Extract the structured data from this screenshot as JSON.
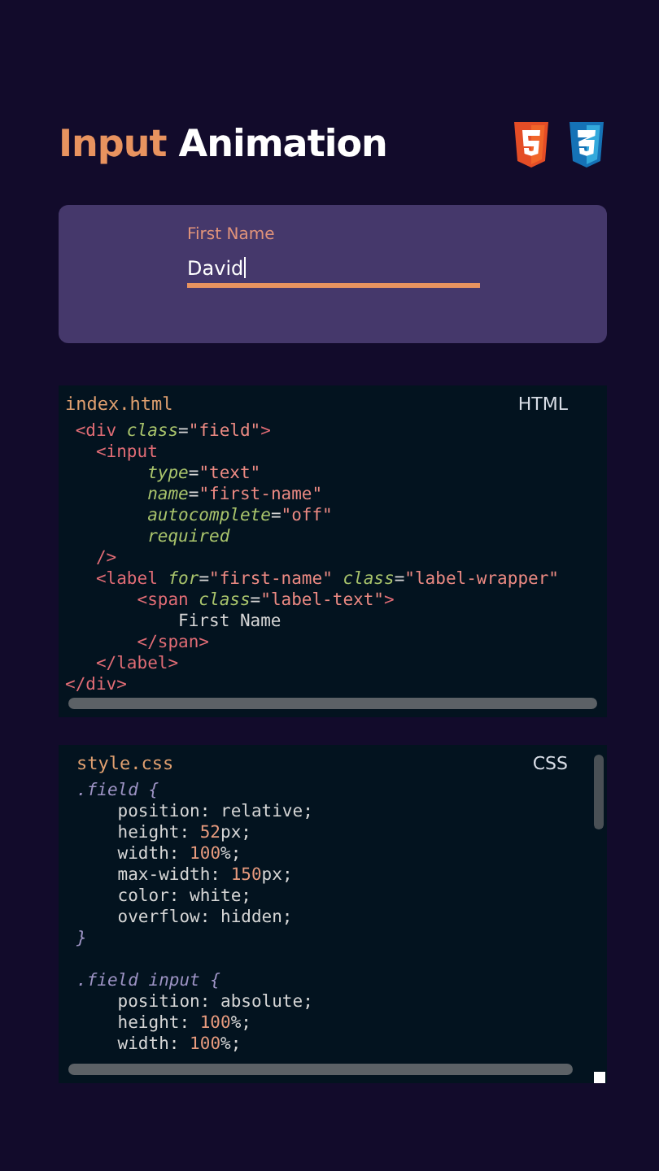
{
  "title": {
    "highlight": "Input",
    "rest": "Animation"
  },
  "form": {
    "label": "First Name",
    "value": "David",
    "focused": true
  },
  "code_panels": [
    {
      "filename": "index.html",
      "language": "HTML",
      "blocks": [
        {
          "lines": [
            {
              "tokens": [
                {
                  "kind": "tag",
                  "text": " <div"
                },
                {
                  "kind": "attr",
                  "text": " class"
                },
                {
                  "kind": "plain",
                  "text": "="
                },
                {
                  "kind": "str",
                  "text": "\"field\""
                },
                {
                  "kind": "tag",
                  "text": ">"
                }
              ]
            },
            {
              "tokens": [
                {
                  "kind": "tag",
                  "text": "   <input"
                }
              ]
            },
            {
              "tokens": [
                {
                  "kind": "attr",
                  "text": "        type"
                },
                {
                  "kind": "plain",
                  "text": "="
                },
                {
                  "kind": "str",
                  "text": "\"text\""
                }
              ]
            },
            {
              "tokens": [
                {
                  "kind": "attr",
                  "text": "        name"
                },
                {
                  "kind": "plain",
                  "text": "="
                },
                {
                  "kind": "str",
                  "text": "\"first-name\""
                }
              ]
            },
            {
              "tokens": [
                {
                  "kind": "attr",
                  "text": "        autocomplete"
                },
                {
                  "kind": "plain",
                  "text": "="
                },
                {
                  "kind": "str",
                  "text": "\"off\""
                }
              ]
            },
            {
              "tokens": [
                {
                  "kind": "attr",
                  "text": "        required"
                }
              ]
            },
            {
              "tokens": [
                {
                  "kind": "tag",
                  "text": "   />"
                }
              ]
            },
            {
              "tokens": [
                {
                  "kind": "tag",
                  "text": "   <label"
                },
                {
                  "kind": "attr",
                  "text": " for"
                },
                {
                  "kind": "plain",
                  "text": "="
                },
                {
                  "kind": "str",
                  "text": "\"first-name\""
                },
                {
                  "kind": "attr",
                  "text": " class"
                },
                {
                  "kind": "plain",
                  "text": "="
                },
                {
                  "kind": "str",
                  "text": "\"label-wrapper\""
                }
              ]
            },
            {
              "tokens": [
                {
                  "kind": "tag",
                  "text": "       <span"
                },
                {
                  "kind": "attr",
                  "text": " class"
                },
                {
                  "kind": "plain",
                  "text": "="
                },
                {
                  "kind": "str",
                  "text": "\"label-text\""
                },
                {
                  "kind": "tag",
                  "text": ">"
                }
              ]
            },
            {
              "tokens": [
                {
                  "kind": "plain",
                  "text": "           First Name"
                }
              ]
            },
            {
              "tokens": [
                {
                  "kind": "tag",
                  "text": "       </span>"
                }
              ]
            },
            {
              "tokens": [
                {
                  "kind": "tag",
                  "text": "   </label>"
                }
              ]
            },
            {
              "tokens": [
                {
                  "kind": "tag",
                  "text": "</div>"
                }
              ]
            }
          ]
        }
      ]
    },
    {
      "filename": "style.css",
      "language": "CSS",
      "blocks": [
        {
          "lines": [
            {
              "tokens": [
                {
                  "kind": "sel",
                  "text": ".field {"
                }
              ]
            },
            {
              "tokens": [
                {
                  "kind": "plain",
                  "text": "    position: relative;"
                }
              ]
            },
            {
              "tokens": [
                {
                  "kind": "plain",
                  "text": "    height: "
                },
                {
                  "kind": "num",
                  "text": "52"
                },
                {
                  "kind": "plain",
                  "text": "px;"
                }
              ]
            },
            {
              "tokens": [
                {
                  "kind": "plain",
                  "text": "    width: "
                },
                {
                  "kind": "num",
                  "text": "100"
                },
                {
                  "kind": "plain",
                  "text": "%;"
                }
              ]
            },
            {
              "tokens": [
                {
                  "kind": "plain",
                  "text": "    max-width: "
                },
                {
                  "kind": "num",
                  "text": "150"
                },
                {
                  "kind": "plain",
                  "text": "px;"
                }
              ]
            },
            {
              "tokens": [
                {
                  "kind": "plain",
                  "text": "    color: white;"
                }
              ]
            },
            {
              "tokens": [
                {
                  "kind": "plain",
                  "text": "    overflow: hidden;"
                }
              ]
            },
            {
              "tokens": [
                {
                  "kind": "sel",
                  "text": "}"
                }
              ]
            }
          ]
        },
        {
          "lines": [
            {
              "tokens": [
                {
                  "kind": "sel",
                  "text": ".field input {"
                }
              ]
            },
            {
              "tokens": [
                {
                  "kind": "plain",
                  "text": "    position: absolute;"
                }
              ]
            },
            {
              "tokens": [
                {
                  "kind": "plain",
                  "text": "    height: "
                },
                {
                  "kind": "num",
                  "text": "100"
                },
                {
                  "kind": "plain",
                  "text": "%;"
                }
              ]
            },
            {
              "tokens": [
                {
                  "kind": "plain",
                  "text": "    width: "
                },
                {
                  "kind": "num",
                  "text": "100"
                },
                {
                  "kind": "plain",
                  "text": "%;"
                }
              ]
            }
          ]
        }
      ]
    }
  ]
}
